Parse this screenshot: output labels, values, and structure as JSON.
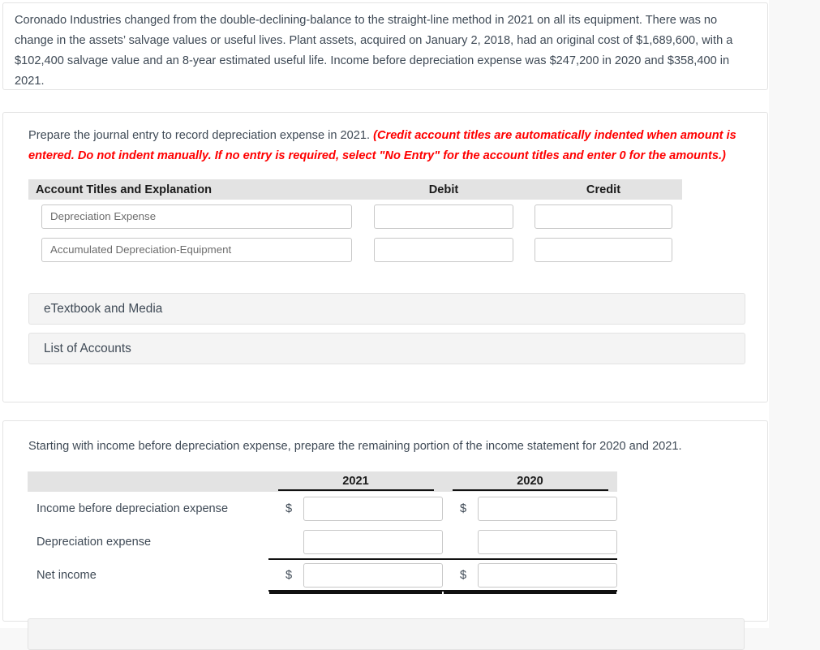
{
  "intro": {
    "text": "Coronado Industries changed from the double-declining-balance to the straight-line method in 2021 on all its equipment. There was no change in the assets’ salvage values or useful lives. Plant assets, acquired on January 2, 2018, had an original cost of $1,689,600, with a $102,400 salvage value and an 8-year estimated useful life. Income before depreciation expense was $247,200 in 2020 and $358,400 in 2021."
  },
  "journal": {
    "prompt_plain": "Prepare the journal entry to record depreciation expense in 2021. ",
    "prompt_red": "(Credit account titles are automatically indented when amount is entered. Do not indent manually. If no entry is required, select \"No Entry\" for the account titles and enter 0 for the amounts.)",
    "columns": {
      "account": "Account Titles and Explanation",
      "debit": "Debit",
      "credit": "Credit"
    },
    "rows": [
      {
        "account": "Depreciation Expense",
        "debit": "",
        "credit": ""
      },
      {
        "account": "Accumulated Depreciation-Equipment",
        "debit": "",
        "credit": ""
      }
    ],
    "etextbook_label": "eTextbook and Media",
    "accounts_label": "List of Accounts"
  },
  "income": {
    "prompt": "Starting with income before depreciation expense, prepare the remaining portion of the income statement for 2020 and 2021.",
    "columns": {
      "blank": "",
      "year_left": "2021",
      "year_right": "2020"
    },
    "currency_symbol": "$",
    "rows": [
      {
        "label": "Income before depreciation expense",
        "show_dollar": true,
        "left": "",
        "right": ""
      },
      {
        "label": "Depreciation expense",
        "show_dollar": false,
        "left": "",
        "right": ""
      },
      {
        "label": "Net income",
        "show_dollar": true,
        "left": "",
        "right": ""
      }
    ]
  },
  "colors": {
    "text": "#3f4a56",
    "alert_red": "#ff0000",
    "header_grey": "#e3e3e3",
    "button_grey": "#f4f4f4",
    "page_bg": "#f8f8f8"
  }
}
